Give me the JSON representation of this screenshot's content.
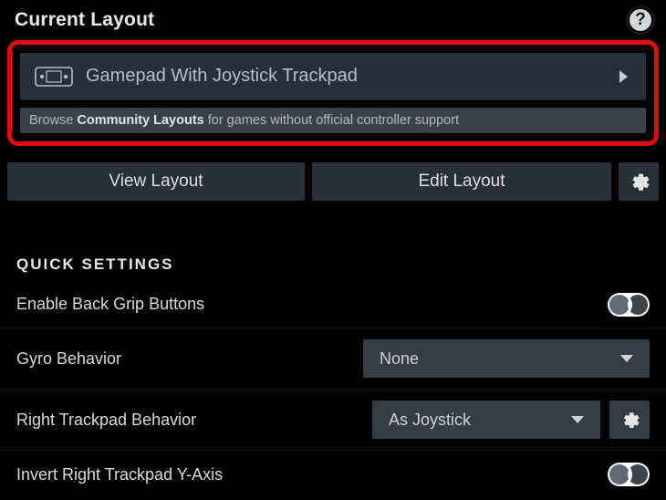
{
  "header": {
    "title": "Current Layout"
  },
  "layout_card": {
    "name": "Gamepad With Joystick Trackpad",
    "community_prefix": "Browse",
    "community_bold": "Community Layouts",
    "community_suffix": "for games without official controller support"
  },
  "actions": {
    "view": "View Layout",
    "edit": "Edit Layout"
  },
  "quick_settings": {
    "heading": "QUICK SETTINGS",
    "rows": {
      "back_grip": {
        "label": "Enable Back Grip Buttons",
        "value": false
      },
      "gyro": {
        "label": "Gyro Behavior",
        "value": "None"
      },
      "rtrackpad": {
        "label": "Right Trackpad Behavior",
        "value": "As Joystick"
      },
      "invert_rt": {
        "label": "Invert Right Trackpad Y-Axis",
        "value": false
      }
    }
  }
}
